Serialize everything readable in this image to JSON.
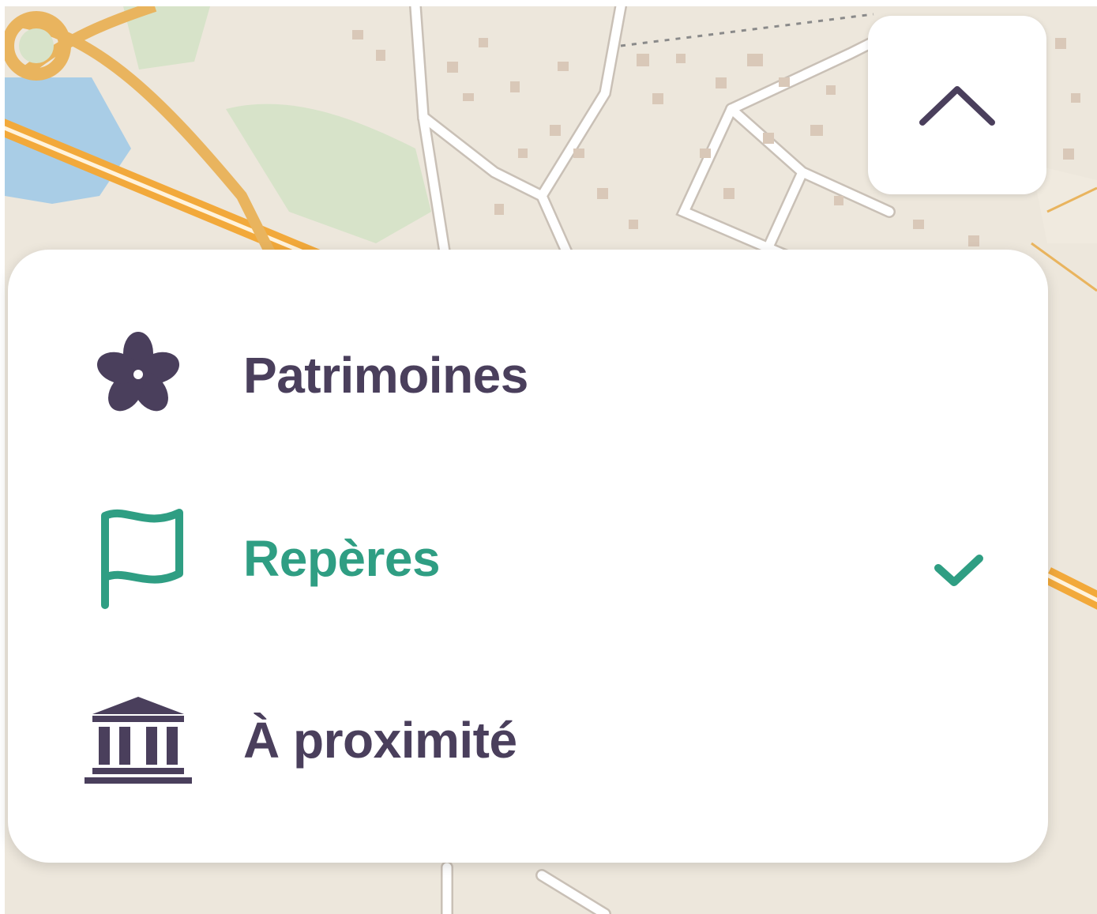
{
  "colors": {
    "text_default": "#4a3f5c",
    "text_active": "#2f9e83",
    "map_land": "#ede7dc",
    "map_road_major": "#f2a93b",
    "map_road_minor": "#ffffff",
    "map_water": "#a9cde6",
    "map_green": "#d7e3c9",
    "map_building": "#d9c8b8"
  },
  "header": {
    "collapse_icon": "chevron-up-icon"
  },
  "menu": {
    "items": [
      {
        "label": "Patrimoines",
        "icon": "flower-icon",
        "active": false
      },
      {
        "label": "Repères",
        "icon": "flag-icon",
        "active": true
      },
      {
        "label": "À proximité",
        "icon": "museum-icon",
        "active": false
      }
    ],
    "active_indicator_icon": "checkmark-icon"
  }
}
